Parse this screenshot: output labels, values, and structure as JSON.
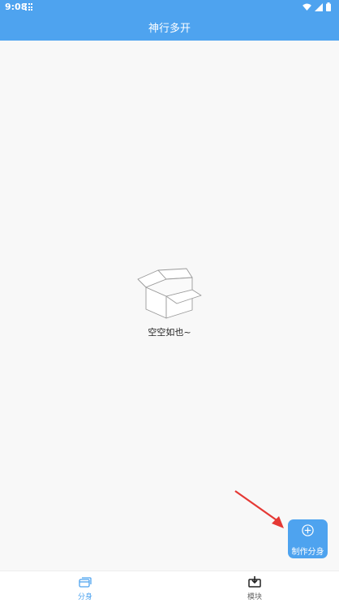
{
  "status_bar": {
    "time": "9:08"
  },
  "header": {
    "title": "神行多开"
  },
  "empty_state": {
    "text": "空空如也~"
  },
  "fab": {
    "label": "制作分身"
  },
  "bottom_nav": {
    "items": [
      {
        "label": "分身",
        "icon": "clone-icon",
        "active": true
      },
      {
        "label": "模块",
        "icon": "download-box-icon",
        "active": false
      }
    ]
  },
  "colors": {
    "accent": "#4ea3ef",
    "background": "#f8f8f8",
    "arrow": "#e53935"
  }
}
